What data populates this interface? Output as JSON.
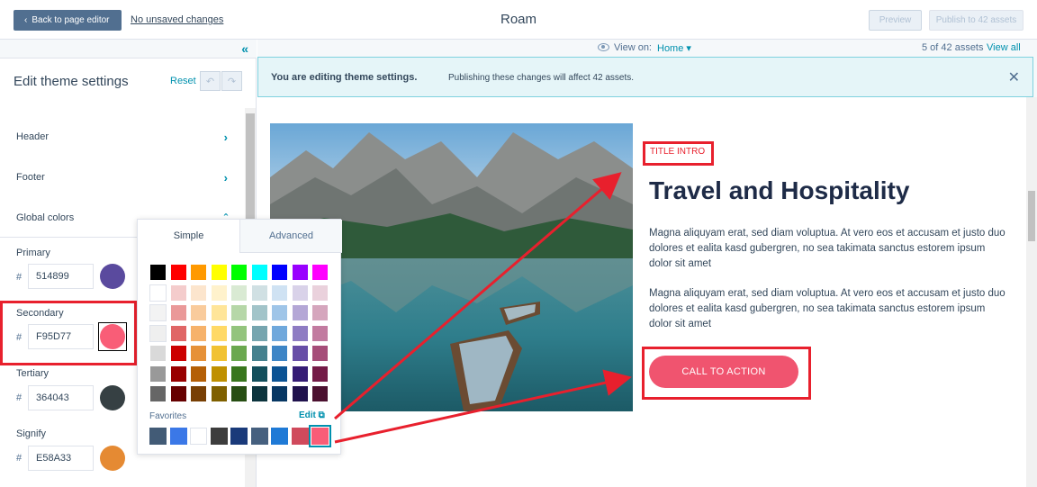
{
  "topbar": {
    "back_label": "Back to page editor",
    "unsaved_label": "No unsaved changes",
    "app_title": "Roam",
    "preview_label": "Preview",
    "publish_label": "Publish to 42 assets"
  },
  "sidebar": {
    "title": "Edit theme settings",
    "reset_label": "Reset",
    "nav": [
      {
        "label": "Header"
      },
      {
        "label": "Footer"
      },
      {
        "label": "Global colors"
      }
    ],
    "colors": [
      {
        "label": "Primary",
        "hash": "#",
        "hex": "514899",
        "color": "#5a4a9e"
      },
      {
        "label": "Secondary",
        "hash": "#",
        "hex": "F95D77",
        "color": "#f95d77"
      },
      {
        "label": "Tertiary",
        "hash": "#",
        "hex": "364043",
        "color": "#364043"
      },
      {
        "label": "Signify",
        "hash": "#",
        "hex": "E58A33",
        "color": "#e58a33"
      }
    ]
  },
  "viewbar": {
    "view_on_label": "View on:",
    "view_on_value": "Home ▾",
    "assets_count": "5 of 42 assets",
    "view_all": "View all"
  },
  "banner": {
    "strong": "You are editing theme settings.",
    "text": "Publishing these changes will affect 42 assets."
  },
  "preview": {
    "title_intro": "TITLE INTRO",
    "headline": "Travel and Hospitality",
    "paragraph1": "Magna aliquyam erat, sed diam voluptua. At vero eos et accusam et justo duo dolores et ealita kasd gubergren, no sea takimata sanctus estorem ipsum dolor sit amet",
    "paragraph2": "Magna aliquyam erat, sed diam voluptua. At vero eos et accusam et justo duo dolores et ealita kasd gubergren, no sea takimata sanctus estorem ipsum dolor sit amet",
    "cta_label": "CALL TO ACTION"
  },
  "picker": {
    "tab_simple": "Simple",
    "tab_advanced": "Advanced",
    "favorites_label": "Favorites",
    "edit_label": "Edit ⧉",
    "grid": [
      [
        "#000000",
        "#ff0000",
        "#ff9900",
        "#ffff00",
        "#00ff00",
        "#00ffff",
        "#0000ff",
        "#9900ff",
        "#ff00ff"
      ],
      [
        "#ffffff",
        "#f4cccc",
        "#fce5cd",
        "#fff2cc",
        "#d9ead3",
        "#d0e0e3",
        "#cfe2f3",
        "#d9d2e9",
        "#ead1dc"
      ],
      [
        "#f3f3f3",
        "#ea9999",
        "#f9cb9c",
        "#ffe599",
        "#b6d7a8",
        "#a2c4c9",
        "#9fc5e8",
        "#b4a7d6",
        "#d5a6bd"
      ],
      [
        "#efefef",
        "#e06666",
        "#f6b26b",
        "#ffd966",
        "#93c47d",
        "#76a5af",
        "#6fa8dc",
        "#8e7cc3",
        "#c27ba0"
      ],
      [
        "#d9d9d9",
        "#cc0000",
        "#e69138",
        "#f1c232",
        "#6aa84f",
        "#45818e",
        "#3d85c6",
        "#674ea7",
        "#a64d79"
      ],
      [
        "#999999",
        "#990000",
        "#b45f06",
        "#bf9000",
        "#38761d",
        "#134f5c",
        "#0b5394",
        "#351c75",
        "#741b47"
      ],
      [
        "#666666",
        "#660000",
        "#783f04",
        "#7f6000",
        "#274e13",
        "#0c343d",
        "#073763",
        "#20124d",
        "#4c1130"
      ]
    ],
    "favorites": [
      "#425b76",
      "#3b78e7",
      "#ffffff",
      "#3d3d3d",
      "#1a3a7a",
      "#46607f",
      "#1f7ad6",
      "#d04a5c",
      "#f95d77"
    ]
  }
}
